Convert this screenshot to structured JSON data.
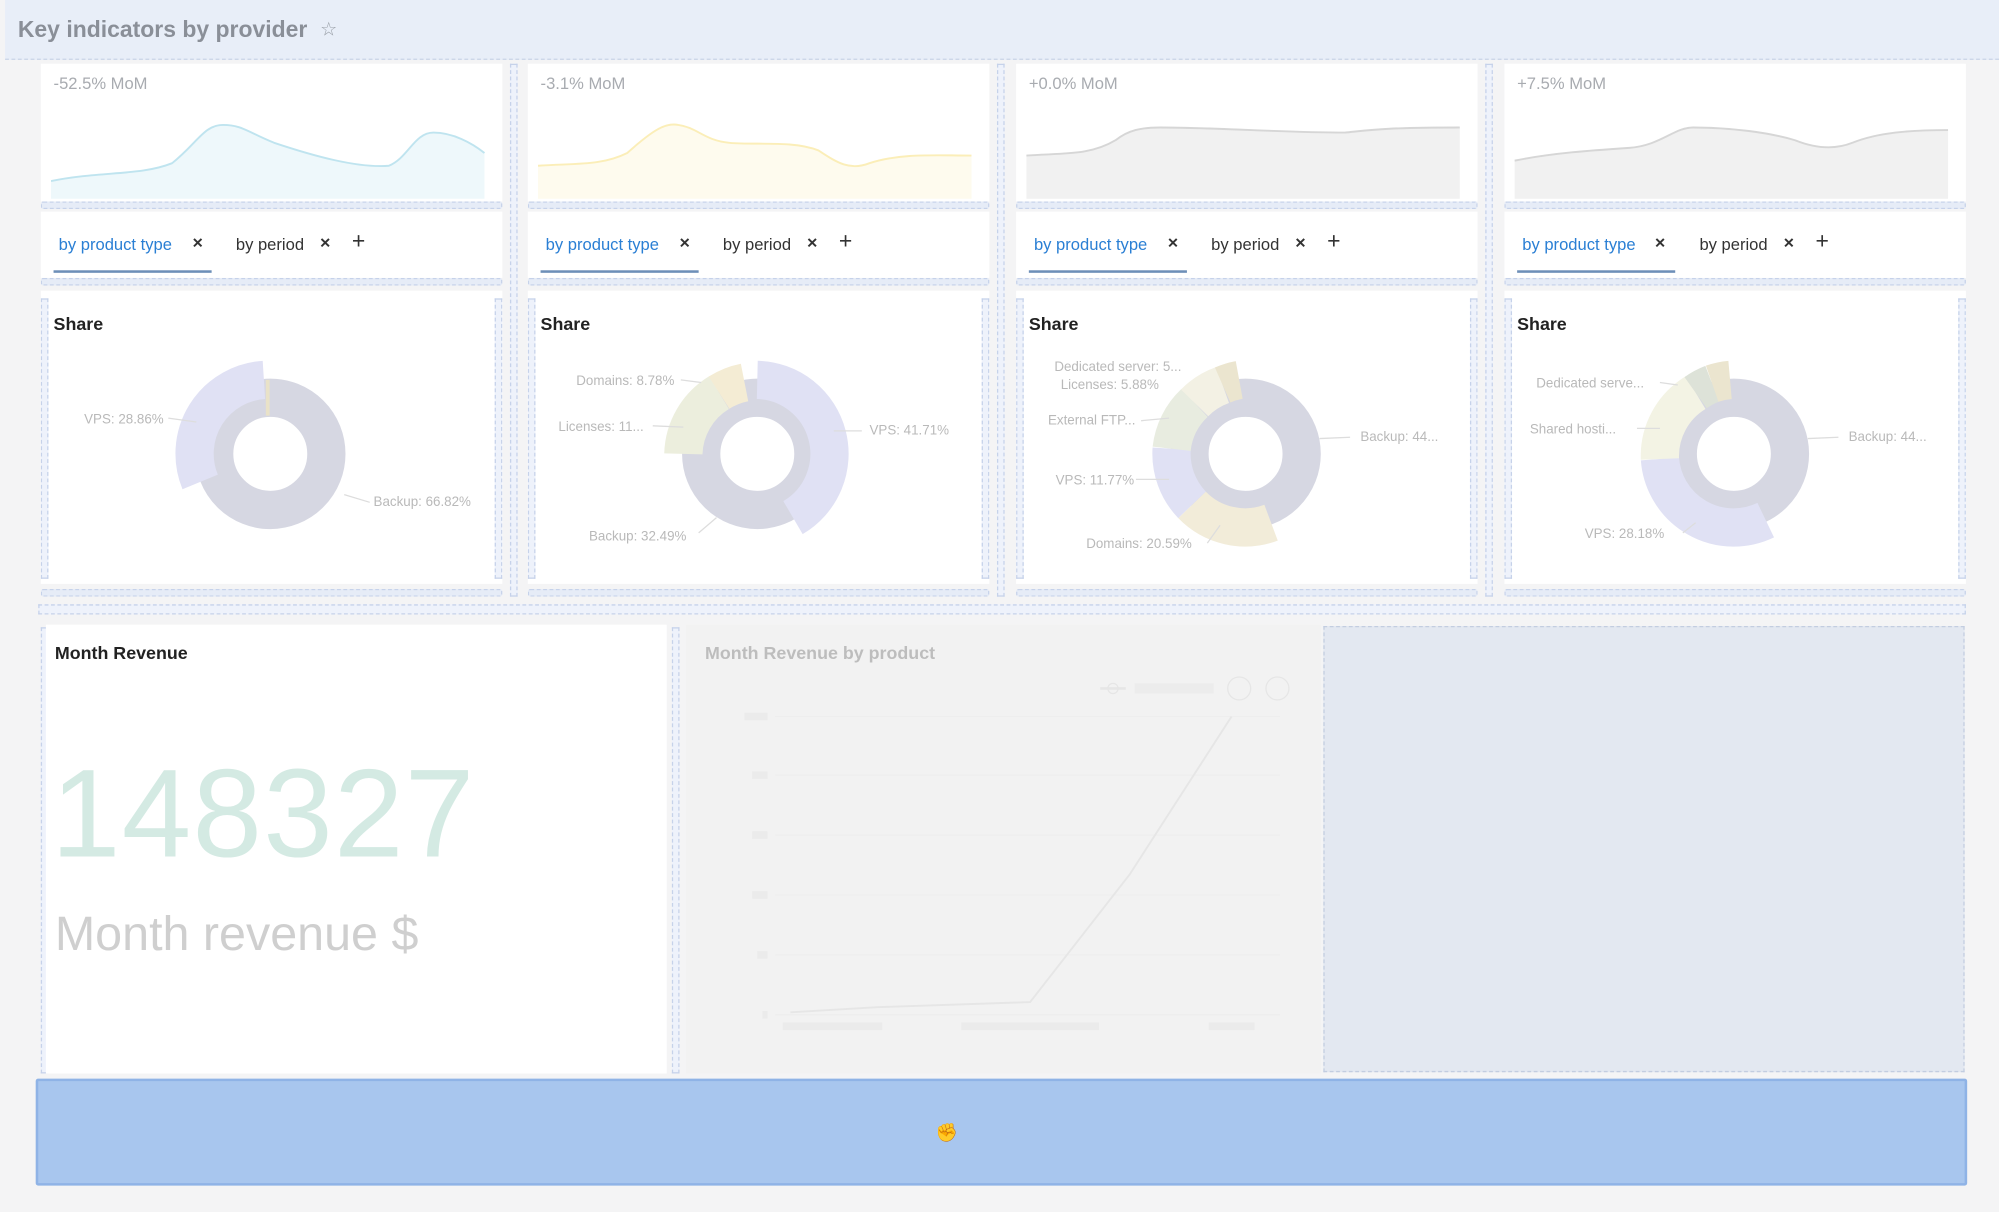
{
  "header": {
    "title": "Key indicators by provider"
  },
  "providers": [
    {
      "mom": "-52.5% MoM",
      "spark_color": "#bfe4ef",
      "tabs": [
        "by product type",
        "by period"
      ],
      "share_title": "Share",
      "share_labels": [
        "VPS: 28.86%",
        "Backup: 66.82%"
      ]
    },
    {
      "mom": "-3.1% MoM",
      "spark_color": "#fbeeb8",
      "tabs": [
        "by product type",
        "by period"
      ],
      "share_title": "Share",
      "share_labels": [
        "Domains: 8.78%",
        "Licenses: 11...",
        "VPS: 41.71%",
        "Backup: 32.49%"
      ]
    },
    {
      "mom": "+0.0% MoM",
      "spark_color": "#d6d6d6",
      "tabs": [
        "by product type",
        "by period"
      ],
      "share_title": "Share",
      "share_labels": [
        "Dedicated server: 5...",
        "Licenses: 5.88%",
        "External FTP...",
        "VPS: 11.77%",
        "Domains: 20.59%",
        "Backup: 44..."
      ]
    },
    {
      "mom": "+7.5% MoM",
      "spark_color": "#d6d6d6",
      "tabs": [
        "by product type",
        "by period"
      ],
      "share_title": "Share",
      "share_labels": [
        "Dedicated serve...",
        "Shared hosti...",
        "VPS: 28.18%",
        "Backup: 44..."
      ]
    }
  ],
  "revenue": {
    "title": "Month Revenue",
    "value": "148327",
    "caption": "Month revenue $"
  },
  "revenue_by_product": {
    "title": "Month Revenue by product"
  },
  "colors": {
    "donut_main": "#d6d7e2",
    "donut_vps": "#e0e1f4",
    "accent_tab": "#2a7fd4",
    "dropzone": "#a8c6ee"
  }
}
